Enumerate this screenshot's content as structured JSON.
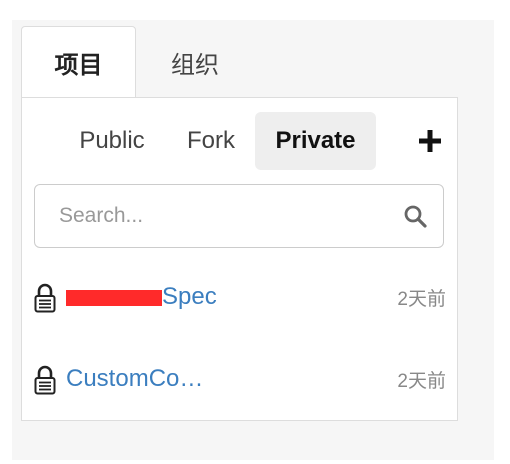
{
  "tabs": [
    {
      "label": "项目",
      "active": true
    },
    {
      "label": "组织",
      "active": false
    }
  ],
  "filters": {
    "public_label": "Public",
    "fork_label": "Fork",
    "private_label": "Private",
    "selected": "Private",
    "add_icon": "plus-icon"
  },
  "search": {
    "placeholder": "Search...",
    "value": "",
    "icon": "search-icon"
  },
  "repos": [
    {
      "name": "SearchSpec",
      "visible_suffix": "Spec",
      "time": "2天前",
      "icon": "lock-icon",
      "redacted": true
    },
    {
      "name": "CustomCo…",
      "time": "2天前",
      "icon": "lock-icon",
      "redacted": false
    }
  ],
  "colors": {
    "link": "#3b7ebf",
    "active_filter_bg": "#eeeeee",
    "redaction": "#ff2a2a"
  }
}
